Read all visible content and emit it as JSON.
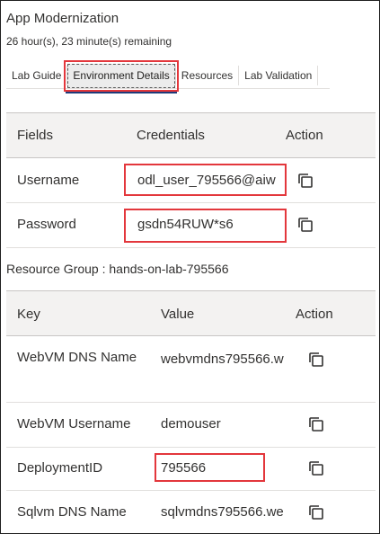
{
  "header": {
    "title": "App Modernization",
    "time_remaining": "26 hour(s), 23 minute(s) remaining"
  },
  "tabs": [
    {
      "label": "Lab Guide",
      "active": false
    },
    {
      "label": "Environment Details",
      "active": true
    },
    {
      "label": "Resources",
      "active": false
    },
    {
      "label": "Lab Validation",
      "active": false
    }
  ],
  "credentials_table": {
    "headers": [
      "Fields",
      "Credentials",
      "Action"
    ],
    "rows": [
      {
        "field": "Username",
        "value": "odl_user_795566@aiw"
      },
      {
        "field": "Password",
        "value": "gsdn54RUW*s6"
      }
    ]
  },
  "resource_group": {
    "label": "Resource Group : hands-on-lab-795566"
  },
  "resource_table": {
    "headers": [
      "Key",
      "Value",
      "Action"
    ],
    "rows": [
      {
        "key": "WebVM DNS Name",
        "value": "webvmdns795566.w"
      },
      {
        "key": "WebVM Username",
        "value": "demouser"
      },
      {
        "key": "DeploymentID",
        "value": "795566"
      },
      {
        "key": "Sqlvm DNS Name",
        "value": "sqlvmdns795566.we"
      }
    ]
  },
  "colors": {
    "highlight": "#e3373c",
    "header_bg": "#f3f2f1",
    "tab_underline": "#1f3a7a"
  },
  "icons": {
    "copy": "copy-icon"
  }
}
